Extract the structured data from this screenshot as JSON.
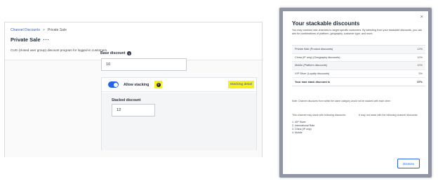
{
  "breadcrumb": {
    "link_label": "Channel Discounts",
    "separator": ">",
    "current_label": "Private Sale"
  },
  "page": {
    "title": "Private Sale",
    "more_glyph": "···",
    "description": "CUG (closed user group) discount program for logged-in customers."
  },
  "base_discount": {
    "label": "Base discount",
    "info_glyph": "i",
    "value": "10"
  },
  "stacking": {
    "toggle_on": true,
    "allow_label": "Allow stacking",
    "help_glyph": "?",
    "detail_link": "Stacking detail",
    "stacked_label": "Stacked discount",
    "stacked_value": "12"
  },
  "modal": {
    "title": "Your stackable discounts",
    "close_glyph": "×",
    "description": "You may combine rate channels to target specific customers. By selecting from your stackable discounts, you can aim for combinations of platform, geography, customer type, and more.",
    "rows": [
      {
        "label": "Private Sale (Product discounts)",
        "value": "12%"
      },
      {
        "label": "China (IP only) (Geography discounts)",
        "value": "10%"
      },
      {
        "label": "Mobile (Platform discounts)",
        "value": "10%"
      },
      {
        "label": "VIP Silver (Loyalty discounts)",
        "value": "5%"
      }
    ],
    "total_label": "Your max stack discount is",
    "total_value": "37%",
    "table_note": "Note: Channel discounts from within the same category would not be stacked with each other.",
    "stack_with_heading": "This channel may stack with following discounts:",
    "stack_with_items": [
      "1. VIP Silver",
      "2. International Rate",
      "3. China (IP only)",
      "4. Mobile"
    ],
    "not_stack_heading": "It may not stack with the following channel discounts:",
    "dismiss_label": "Dismiss"
  },
  "colors": {
    "accent": "#2563eb",
    "highlight": "#f5f01e",
    "modal_border": "#8f95a3"
  }
}
